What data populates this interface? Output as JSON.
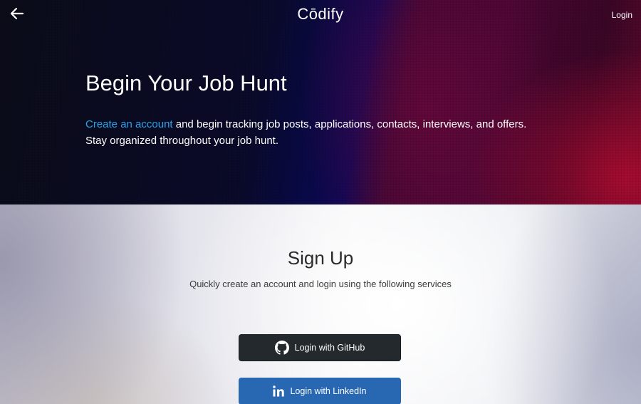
{
  "header": {
    "brand": "Cōdify",
    "login_label": "Login",
    "back_icon": "arrow-left-icon"
  },
  "hero": {
    "title": "Begin Your Job Hunt",
    "link_text": "Create an account",
    "text_after_link": " and begin tracking job posts, applications, contacts, interviews, and offers.",
    "text_line2": "Stay organized throughout your job hunt."
  },
  "signup": {
    "title": "Sign Up",
    "subtitle": "Quickly create an account and login using the following services",
    "github_label": "Login with GitHub",
    "github_icon": "github-icon",
    "linkedin_label": "Login with LinkedIn",
    "linkedin_icon": "linkedin-icon"
  },
  "colors": {
    "link": "#29a3ea",
    "github_button": "#24292e",
    "linkedin_button": "#2867b2"
  }
}
